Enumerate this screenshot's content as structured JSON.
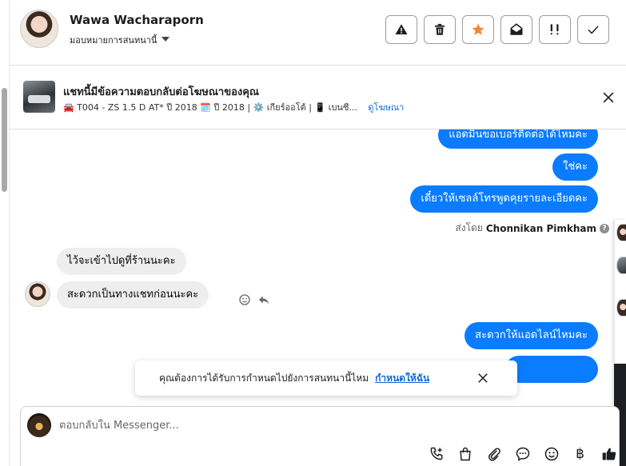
{
  "header": {
    "user_name": "Wawa Wacharaporn",
    "assign_label": "มอบหมายการสนทนานี้",
    "tools": [
      {
        "name": "report-spam-icon"
      },
      {
        "name": "trash-icon"
      },
      {
        "name": "star-icon"
      },
      {
        "name": "mark-unread-icon"
      },
      {
        "name": "follow-up-icon"
      },
      {
        "name": "mark-done-icon"
      }
    ]
  },
  "ad": {
    "title": "แชทนี้มีข้อความตอบกลับต่อโฆษณาของคุณ",
    "subtitle": "🚘 T004 - ZS 1.5 D AT* ปี 2018 🗓️ ปี 2018 | ⚙️ เกียร์ออโต้ | 📱 เบนซี...",
    "link": "ดูโฆษณา"
  },
  "messages": {
    "out_1": "แอดมินขอเบอร์ติดต่อได้ไหมคะ",
    "out_2": "ใช่คะ",
    "out_3": "เดี๋ยวให้เซลล์โทรพูดคุยรายละเอียดคะ",
    "sent_by_prefix": "ส่งโดย",
    "sent_by_name": "Chonnikan Pimkham",
    "in_1": "ไว้จะเข้าไปดูที่ร้านนะคะ",
    "in_2": "สะดวกเป็นทางแชทก่อนนะคะ",
    "out_4": "สะดวกให้แอดไลน์ไหมคะ"
  },
  "toast": {
    "text": "คุณต้องการได้รับการกำหนดไปยังการสนทนานี้ไหม",
    "link": "กำหนดให้ฉัน"
  },
  "composer": {
    "placeholder": "ตอบกลับใน Messenger...",
    "baht_symbol": "฿"
  },
  "colors": {
    "outgoing_bubble": "#0a7cff",
    "incoming_bubble": "#eeeeee",
    "link_blue": "#1467d6",
    "star_orange": "#f5862e"
  }
}
